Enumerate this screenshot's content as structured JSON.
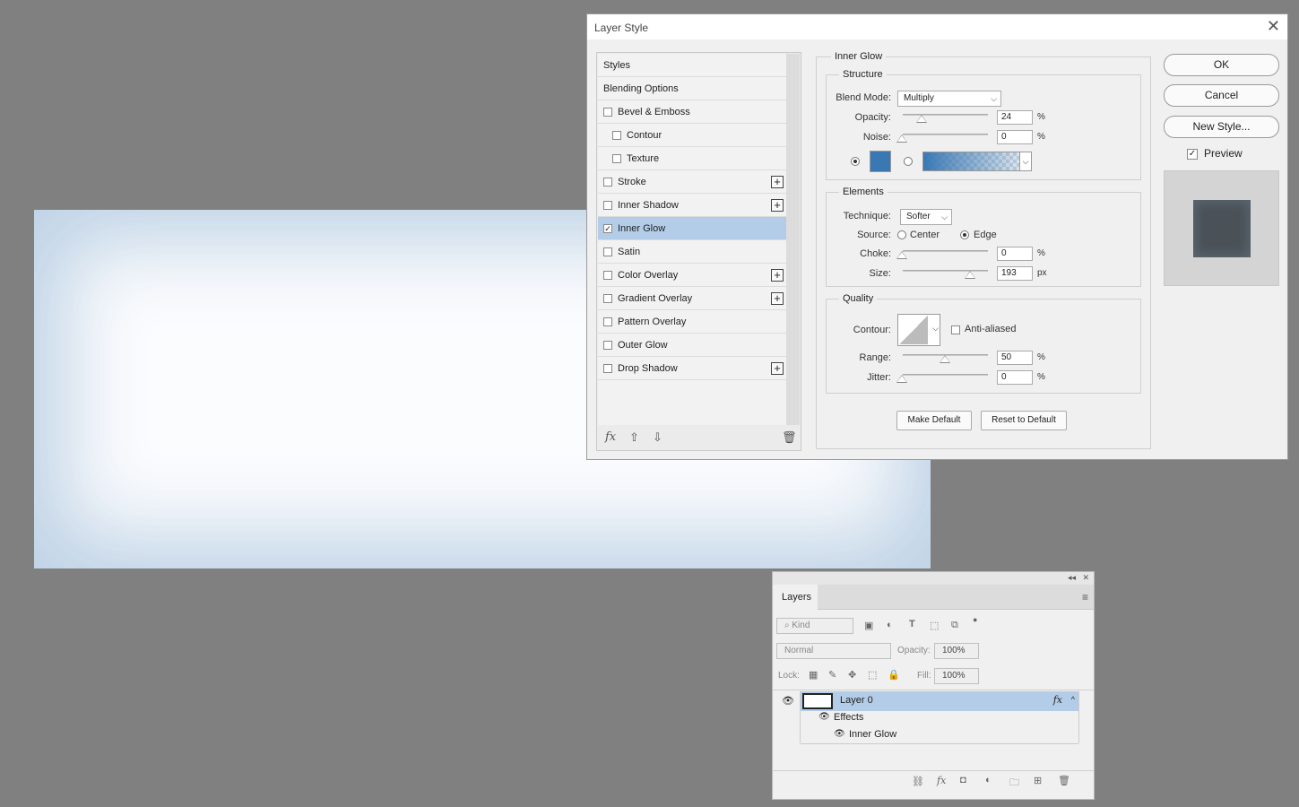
{
  "dialog": {
    "title": "Layer Style",
    "styles_list": [
      {
        "label": "Styles",
        "type": "header"
      },
      {
        "label": "Blending Options",
        "type": "header"
      },
      {
        "label": "Bevel & Emboss",
        "type": "item",
        "checked": false,
        "plus": false
      },
      {
        "label": "Contour",
        "type": "sub",
        "checked": false,
        "plus": false
      },
      {
        "label": "Texture",
        "type": "sub",
        "checked": false,
        "plus": false
      },
      {
        "label": "Stroke",
        "type": "item",
        "checked": false,
        "plus": true
      },
      {
        "label": "Inner Shadow",
        "type": "item",
        "checked": false,
        "plus": true
      },
      {
        "label": "Inner Glow",
        "type": "item",
        "checked": true,
        "plus": false,
        "active": true
      },
      {
        "label": "Satin",
        "type": "item",
        "checked": false,
        "plus": false
      },
      {
        "label": "Color Overlay",
        "type": "item",
        "checked": false,
        "plus": true
      },
      {
        "label": "Gradient Overlay",
        "type": "item",
        "checked": false,
        "plus": true
      },
      {
        "label": "Pattern Overlay",
        "type": "item",
        "checked": false,
        "plus": false
      },
      {
        "label": "Outer Glow",
        "type": "item",
        "checked": false,
        "plus": false
      },
      {
        "label": "Drop Shadow",
        "type": "item",
        "checked": false,
        "plus": true
      }
    ],
    "settings": {
      "section_title": "Inner Glow",
      "structure": {
        "title": "Structure",
        "blend_mode_label": "Blend Mode:",
        "blend_mode": "Multiply",
        "opacity_label": "Opacity:",
        "opacity": "24",
        "noise_label": "Noise:",
        "noise": "0",
        "percent": "%",
        "glow_color": "#3a78b4"
      },
      "elements": {
        "title": "Elements",
        "technique_label": "Technique:",
        "technique": "Softer",
        "source_label": "Source:",
        "source_center": "Center",
        "source_edge": "Edge",
        "choke_label": "Choke:",
        "choke": "0",
        "size_label": "Size:",
        "size": "193",
        "px": "px"
      },
      "quality": {
        "title": "Quality",
        "contour_label": "Contour:",
        "anti_aliased": "Anti-aliased",
        "range_label": "Range:",
        "range": "50",
        "jitter_label": "Jitter:",
        "jitter": "0"
      },
      "make_default": "Make Default",
      "reset_default": "Reset to Default"
    },
    "buttons": {
      "ok": "OK",
      "cancel": "Cancel",
      "new_style": "New Style...",
      "preview": "Preview"
    }
  },
  "layers": {
    "tab": "Layers",
    "kind_placeholder": "Kind",
    "blend_mode": "Normal",
    "opacity_label": "Opacity:",
    "opacity": "100%",
    "lock_label": "Lock:",
    "fill_label": "Fill:",
    "fill": "100%",
    "layer_name": "Layer 0",
    "effects_label": "Effects",
    "effect_item": "Inner Glow"
  }
}
